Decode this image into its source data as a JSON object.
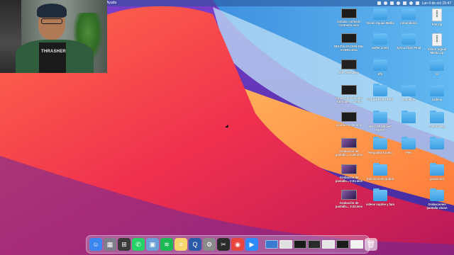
{
  "menubar": {
    "app_menu": "Ayuda",
    "datetime": "Lun 4 de oct  15:47"
  },
  "webcam": {
    "shirt_text": "THRASHER"
  },
  "desktop": {
    "items": [
      {
        "label": "instalar contacto Contacto.mov",
        "kind": "video"
      },
      {
        "label": "Vision Squad Media",
        "kind": "folder"
      },
      {
        "label": "inmobiliaria",
        "kind": "folder"
      },
      {
        "label": "Flet.zip",
        "kind": "zip"
      },
      {
        "label": "REUTILIZACION DEL ACERO.mov",
        "kind": "video"
      },
      {
        "label": "walter acero",
        "kind": "folder"
      },
      {
        "label": "Jyrica Clips Final",
        "kind": "folder"
      },
      {
        "label": "Vision Squad Media.zip",
        "kind": "zip"
      },
      {
        "label": "DJI_0159.MOV",
        "kind": "doc"
      },
      {
        "label": "dfv",
        "kind": "folder"
      },
      {
        "label": "zz",
        "kind": "folder"
      },
      {
        "label": "cadena",
        "kind": "folder"
      },
      {
        "label": "Convertir lista para Tutoriales - 1.mov",
        "kind": "video"
      },
      {
        "label": "CODEDFOR APPS",
        "kind": "folder"
      },
      {
        "label": "Inmueble",
        "kind": "folder"
      },
      {
        "label": "",
        "kind": "folder"
      },
      {
        "label": "chatbot 10.25.mov",
        "kind": "video"
      },
      {
        "label": "NO COPYRIGHT MUSIC",
        "kind": "folder"
      },
      {
        "label": "",
        "kind": "folder"
      },
      {
        "label": "cuenta key",
        "kind": "folder"
      },
      {
        "label": "Grabación de pantalla... 5.28.mov",
        "kind": "video-screen"
      },
      {
        "label": "Respaldo Azotea",
        "kind": "folder"
      },
      {
        "label": "Flet",
        "kind": "folder"
      },
      {
        "label": "",
        "kind": "folder"
      },
      {
        "label": "Grabación de pantalla... 0.01.mov",
        "kind": "video-screen"
      },
      {
        "label": "transiciones grabar",
        "kind": "folder"
      },
      {
        "label": "grabacion",
        "kind": "folder"
      },
      {
        "label": "Grabación de pantalla... 3.32.mov",
        "kind": "video-screen"
      },
      {
        "label": "videos sophie y fam",
        "kind": "folder"
      },
      {
        "label": "Grabaciones pantalla vision",
        "kind": "folder"
      }
    ]
  },
  "dock": {
    "apps": [
      {
        "name": "finder",
        "glyph": "☺",
        "color": "#3b86f0"
      },
      {
        "name": "launchpad",
        "glyph": "▦",
        "color": "#7d7d8c"
      },
      {
        "name": "calculator",
        "glyph": "⊞",
        "color": "#3a3a3a"
      },
      {
        "name": "whatsapp",
        "glyph": "✆",
        "color": "#25d366"
      },
      {
        "name": "preview",
        "glyph": "▣",
        "color": "#6aa0d8"
      },
      {
        "name": "spotify",
        "glyph": "≋",
        "color": "#1db954"
      },
      {
        "name": "notes",
        "glyph": "≡",
        "color": "#f5d76e"
      },
      {
        "name": "quicktime",
        "glyph": "Q",
        "color": "#2a5aa8"
      },
      {
        "name": "system-preferences",
        "glyph": "⚙",
        "color": "#8a8a8a"
      },
      {
        "name": "final-cut",
        "glyph": "✂",
        "color": "#2a2a2a"
      },
      {
        "name": "chrome",
        "glyph": "◉",
        "color": "#e8453c"
      },
      {
        "name": "zoom",
        "glyph": "▶",
        "color": "#2d8cff"
      }
    ],
    "windows": [
      "#3a7bd0",
      "#e0e0e0",
      "#1a1a1a",
      "#2a2a2a",
      "#e6e6e6",
      "#1a1a1a",
      "#f2f2f2"
    ],
    "trash_glyph": "🗑"
  }
}
